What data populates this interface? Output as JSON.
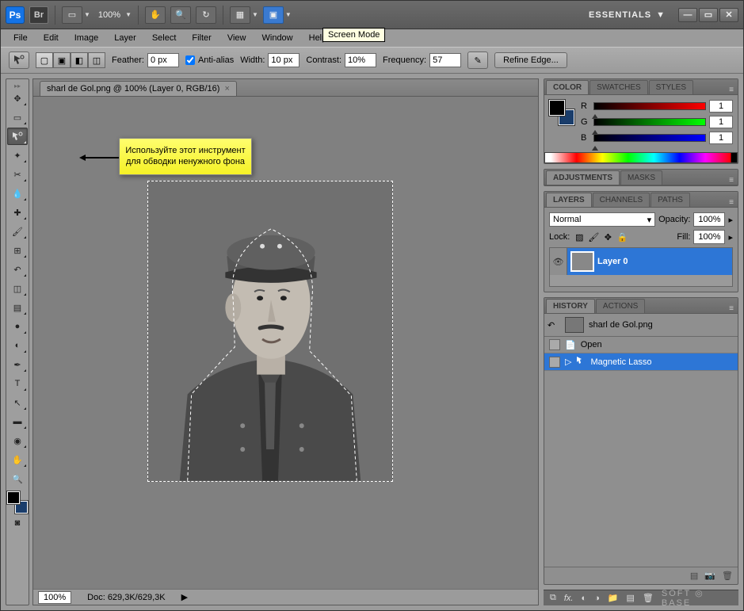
{
  "titlebar": {
    "zoom": "100%",
    "workspace_label": "ESSENTIALS"
  },
  "menubar": {
    "items": [
      "File",
      "Edit",
      "Image",
      "Layer",
      "Select",
      "Filter",
      "View",
      "Window",
      "Help"
    ],
    "tooltip": "Screen Mode"
  },
  "optionbar": {
    "feather_label": "Feather:",
    "feather_value": "0 px",
    "antialias_label": "Anti-alias",
    "width_label": "Width:",
    "width_value": "10 px",
    "contrast_label": "Contrast:",
    "contrast_value": "10%",
    "frequency_label": "Frequency:",
    "frequency_value": "57",
    "refine_label": "Refine Edge..."
  },
  "document": {
    "tab_title": "sharl de Gol.png @ 100% (Layer 0, RGB/16)",
    "status_zoom": "100%",
    "status_doc": "Doc: 629,3K/629,3K"
  },
  "callout": {
    "text": "Используйте этот инструмент для обводки ненужного фона"
  },
  "panels": {
    "color": {
      "tab1": "COLOR",
      "tab2": "SWATCHES",
      "tab3": "STYLES",
      "r_label": "R",
      "g_label": "G",
      "b_label": "B",
      "r": "1",
      "g": "1",
      "b": "1"
    },
    "adjustments": {
      "tab1": "ADJUSTMENTS",
      "tab2": "MASKS"
    },
    "layers": {
      "tab1": "LAYERS",
      "tab2": "CHANNELS",
      "tab3": "PATHS",
      "blend": "Normal",
      "opacity_label": "Opacity:",
      "opacity": "100%",
      "lock_label": "Lock:",
      "fill_label": "Fill:",
      "fill": "100%",
      "layer0": "Layer 0"
    },
    "history": {
      "tab1": "HISTORY",
      "tab2": "ACTIONS",
      "doc_name": "sharl de Gol.png",
      "item_open": "Open",
      "item_mag": "Magnetic Lasso"
    }
  },
  "footer": {
    "brand": "SOFT ◎ BASE"
  }
}
